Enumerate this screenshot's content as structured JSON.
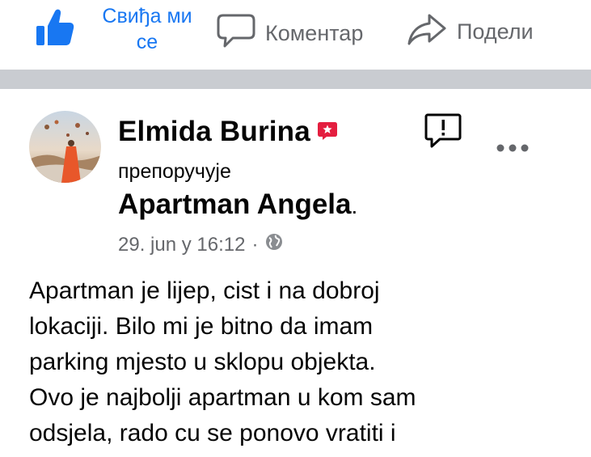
{
  "actions": {
    "like_label_line1": "Свиђа ми",
    "like_label_line2": "се",
    "comment_label": "Коментар",
    "share_label": "Подели"
  },
  "post": {
    "author_name": "Elmida Burina",
    "recommends_label": "препоручује",
    "page_name": "Apartman Angela",
    "page_suffix": ".",
    "date": "29. jun у 16:12",
    "meta_separator": "·",
    "privacy_icon": "globe-icon",
    "body_lines": [
      "Apartman je lijep, cist i na dobroj",
      "lokaciji. Bilo mi je bitno da imam",
      "parking mjesto u sklopu objekta.",
      "Ovo je najbolji apartman u kom sam",
      "odsjela, rado cu se ponovo vratiti i"
    ]
  },
  "colors": {
    "accent": "#1877f2",
    "secondary_text": "#65676b",
    "divider": "#c9ccd1",
    "badge": "#e41e3f"
  }
}
